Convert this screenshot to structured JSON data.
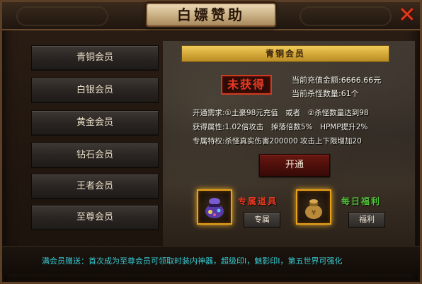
{
  "window": {
    "title": "白嫖赞助",
    "close_icon": "close-icon"
  },
  "sidebar": {
    "items": [
      {
        "label": "青铜会员"
      },
      {
        "label": "白银会员"
      },
      {
        "label": "黄金会员"
      },
      {
        "label": "钻石会员"
      },
      {
        "label": "王者会员"
      },
      {
        "label": "至尊会员"
      }
    ]
  },
  "panel": {
    "tier_title": "青铜会员",
    "status_badge": "未获得",
    "recharge_amount": "当前充值金额:6666.66元",
    "kill_count": "当前杀怪数量:61个",
    "requirement": "开通需求:①土豪98元充值　或者　②杀怪数量达到98",
    "attribute": "获得属性:1.02倍攻击　掉落倍数5%　HPMP提升2%",
    "privilege": "专属特权:杀怪真实伤害200000 攻击上下限增加20",
    "open_button": "开通"
  },
  "rewards": {
    "exclusive_label": "专属道具",
    "exclusive_button": "专属",
    "exclusive_icon": "treasure-bag-icon",
    "daily_label": "每日福利",
    "daily_button": "福利",
    "daily_icon": "money-bag-icon"
  },
  "footer": {
    "note": "满会员赠送：首次成为至尊会员可领取时装内神器，超级印Ⅰ，魅影印Ⅰ，第五世界可强化"
  },
  "colors": {
    "accent_gold": "#e7a21a",
    "status_red": "#e83a22",
    "reward_red": "#e83a22",
    "reward_green": "#52c23a",
    "footer_cyan": "#38c7cf"
  }
}
